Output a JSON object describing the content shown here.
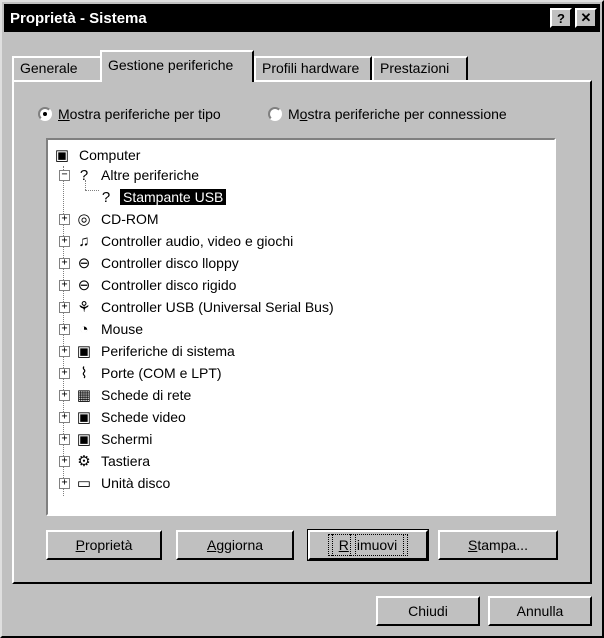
{
  "window": {
    "title": "Proprietà - Sistema",
    "help_label": "?",
    "close_label": "✕"
  },
  "tabs": [
    {
      "label": "Generale"
    },
    {
      "label": "Gestione periferiche"
    },
    {
      "label": "Profili hardware"
    },
    {
      "label": "Prestazioni"
    }
  ],
  "view_options": {
    "by_type": {
      "accel": "M",
      "rest": "ostra periferiche per tipo",
      "checked": true
    },
    "by_connection": {
      "pre": "M",
      "accel": "o",
      "rest": "stra periferiche per connessione",
      "checked": false
    }
  },
  "tree": {
    "root": "Computer",
    "items": [
      {
        "label": "Altre periferiche",
        "icon": "question-icon",
        "expanded": true
      },
      {
        "label": "Stampante USB",
        "icon": "question-icon",
        "child": true,
        "selected": true
      },
      {
        "label": "CD-ROM",
        "icon": "cdrom-icon"
      },
      {
        "label": "Controller audio, video e giochi",
        "icon": "multimedia-icon"
      },
      {
        "label": "Controller disco lloppy",
        "icon": "floppy-controller-icon"
      },
      {
        "label": "Controller disco rigido",
        "icon": "harddisk-controller-icon"
      },
      {
        "label": "Controller USB (Universal Serial Bus)",
        "icon": "usb-icon"
      },
      {
        "label": "Mouse",
        "icon": "mouse-icon"
      },
      {
        "label": "Periferiche di sistema",
        "icon": "system-device-icon"
      },
      {
        "label": "Porte (COM e LPT)",
        "icon": "port-icon"
      },
      {
        "label": "Schede di rete",
        "icon": "network-card-icon"
      },
      {
        "label": "Schede video",
        "icon": "display-adapter-icon"
      },
      {
        "label": "Schermi",
        "icon": "monitor-icon"
      },
      {
        "label": "Tastiera",
        "icon": "keyboard-icon"
      },
      {
        "label": "Unità disco",
        "icon": "disk-drive-icon"
      }
    ]
  },
  "buttons": {
    "properties": {
      "accel": "P",
      "rest": "roprietà"
    },
    "refresh": {
      "accel": "A",
      "rest": "ggiorna"
    },
    "remove": {
      "accel": "R",
      "rest": "imuovi"
    },
    "print": {
      "accel": "S",
      "rest": "tampa..."
    },
    "close": "Chiudi",
    "cancel": "Annulla"
  }
}
